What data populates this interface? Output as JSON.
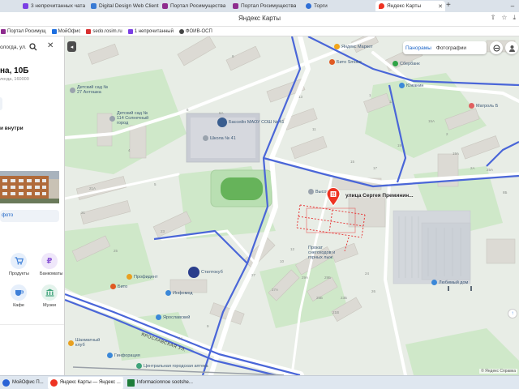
{
  "browser": {
    "tabs": [
      {
        "label": "3 непрочитанных чата",
        "icon_color": "#7b3fe4",
        "active": false
      },
      {
        "label": "Digital Design Web Client",
        "icon_color": "#3a7bd5",
        "active": false
      },
      {
        "label": "Портал Росимущества",
        "icon_color": "#8e2c8e",
        "active": false
      },
      {
        "label": "Портал Росимущества",
        "icon_color": "#8e2c8e",
        "active": false
      },
      {
        "label": "Торги",
        "icon_color": "#2f6fd6",
        "active": false
      },
      {
        "label": "Яндекс Карты",
        "icon_color": "#ee3322",
        "active": true
      }
    ],
    "new_tab": "+",
    "page_heading": "Яндекс Карты",
    "bookmarks": [
      {
        "label": "Портал Росимущ",
        "icon_color": "#8e2c8e"
      },
      {
        "label": "МойОфис",
        "icon_color": "#1d6fe0"
      },
      {
        "label": "sedo.rosim.ru",
        "icon_color": "#d83030"
      },
      {
        "label": "1 непрочитанный",
        "icon_color": "#7b3fe4"
      },
      {
        "label": "ФОИВ-ОСП",
        "icon_color": "#444444"
      }
    ]
  },
  "panel": {
    "search_text": "ологда, ул.",
    "address_title": "на, 10Б",
    "address_sub": "логда, 160000",
    "inside_text": "и внутри",
    "photo_link": "фото",
    "categories": [
      {
        "label": "Продукты",
        "icon": "cart-icon",
        "color": "#3e7fd8"
      },
      {
        "label": "Банкоматы",
        "icon": "ruble-icon",
        "color": "#8d5ad6"
      },
      {
        "label": "Кафе",
        "icon": "cup-icon",
        "color": "#3e7fd8"
      },
      {
        "label": "Музеи",
        "icon": "museum-icon",
        "color": "#3fa37a"
      }
    ]
  },
  "map": {
    "layers": {
      "panoramas": "Панорамы",
      "photos": "Фотографии"
    },
    "pin_label": "улица Сергея Преминин...",
    "street_label": "ЯРОСЛАВСКАЯ УЛ.",
    "copyright": "© Яндекс Справка",
    "pois": [
      {
        "label": "Детский сад № 27 Антошка",
        "dot": "#9aa3ad"
      },
      {
        "label": "Детский сад № 114 Солнечный город",
        "dot": "#9aa3ad"
      },
      {
        "label": "Бассейн МАОУ СОШ № 41",
        "dot": "#3a5d8f"
      },
      {
        "label": "Школа № 41",
        "dot": "#9aa3ad"
      },
      {
        "label": "Яндекс Маркет",
        "dot": "#f2a51a"
      },
      {
        "label": "Бито Smoke",
        "dot": "#e05a22"
      },
      {
        "label": "Южанин",
        "dot": "#3b88d8"
      },
      {
        "label": "Сбербанк",
        "dot": "#2fa346"
      },
      {
        "label": "Матроль Б",
        "dot": "#e06060"
      },
      {
        "label": "Высота",
        "dot": "#9aa3ad"
      },
      {
        "label": "Прокат снегоходов и горных лыж",
        "dot": "#9aa3ad"
      },
      {
        "label": "Профидент",
        "dot": "#e8a020"
      },
      {
        "label": "Бито",
        "dot": "#e05a22"
      },
      {
        "label": "Инфомед",
        "dot": "#3b88d8"
      },
      {
        "label": "Ярославский",
        "dot": "#3b88d8"
      },
      {
        "label": "Гинфорация",
        "dot": "#3b88d8"
      },
      {
        "label": "Шахматный клуб",
        "dot": "#e8a020"
      },
      {
        "label": "Центральная городская аптека",
        "dot": "#3fa37a"
      },
      {
        "label": "Любимый дом",
        "dot": "#3b88d8"
      },
      {
        "label": "Стилтокуб",
        "dot": "#2a3e8c"
      }
    ],
    "house_numbers": [
      "6",
      "6А",
      "8",
      "1",
      "1А",
      "21",
      "21А",
      "23",
      "25",
      "27",
      "11",
      "13",
      "15",
      "17",
      "19",
      "4",
      "2",
      "2А",
      "10",
      "12",
      "27А",
      "25А",
      "29А",
      "29Б",
      "25Б",
      "23Б",
      "21В",
      "24",
      "26",
      "15А",
      "19А",
      "8Б",
      "9",
      "9А",
      "5"
    ]
  },
  "taskbar": {
    "items": [
      {
        "label": "МойОфис П...",
        "icon_color": "#2a63d6",
        "active": false
      },
      {
        "label": "Яндекс Карты — Яндекс ...",
        "icon_color": "#ee3322",
        "active": true
      },
      {
        "label": "Informacionnoe sootshe...",
        "icon_color": "#1e7d3a",
        "active": false
      }
    ]
  }
}
